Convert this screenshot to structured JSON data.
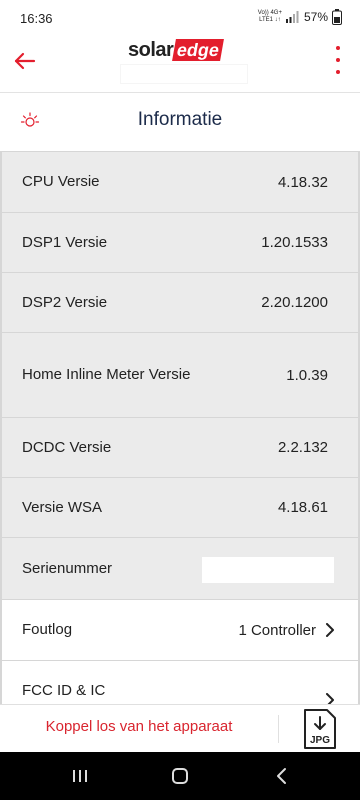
{
  "status_bar": {
    "time": "16:36",
    "net_line1": "Vo)) 4G+",
    "net_line2": "LTE1 ↓↑",
    "battery": "57%"
  },
  "app_bar": {
    "back_icon": "arrow-left-icon",
    "logo_solar": "solar",
    "logo_edge": "edge",
    "menu_icon": "more-vertical-icon",
    "accent_color": "#e31e2d"
  },
  "section": {
    "icon": "sun-icon",
    "title": "Informatie"
  },
  "rows": [
    {
      "label": "CPU Versie",
      "value": "4.18.32"
    },
    {
      "label": "DSP1 Versie",
      "value": "1.20.1533"
    },
    {
      "label": "DSP2 Versie",
      "value": "2.20.1200"
    },
    {
      "label": "Home Inline Meter Versie",
      "value": "1.0.39"
    },
    {
      "label": "DCDC Versie",
      "value": "2.2.132"
    },
    {
      "label": "Versie WSA",
      "value": "4.18.61"
    },
    {
      "label": "Serienummer",
      "value": ""
    },
    {
      "label": "Foutlog",
      "value": "1 Controller"
    },
    {
      "label": "FCC ID & IC",
      "value": ""
    }
  ],
  "bottom": {
    "disconnect_label": "Koppel los van het apparaat",
    "jpg_label": "JPG",
    "jpg_icon": "download-jpg-icon"
  },
  "nav": {
    "recents_icon": "recents-icon",
    "home_icon": "home-icon",
    "back_icon": "nav-back-icon"
  }
}
